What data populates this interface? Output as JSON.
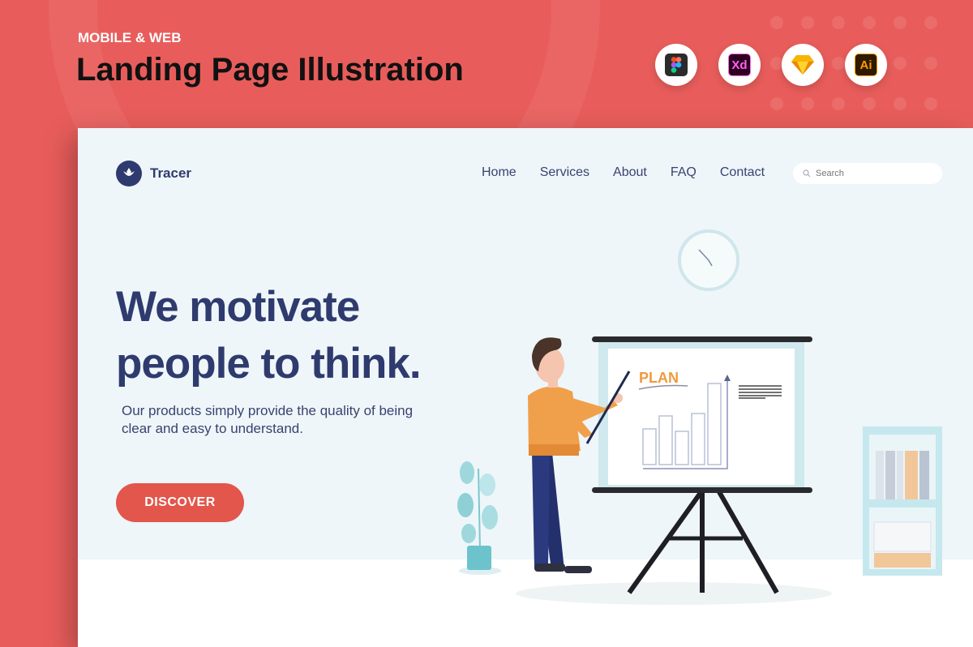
{
  "header": {
    "kicker": "MOBILE & WEB",
    "title": "Landing Page Illustration"
  },
  "tools": [
    {
      "name": "figma-icon",
      "label": ""
    },
    {
      "name": "xd-icon",
      "label": "Xd"
    },
    {
      "name": "sketch-icon",
      "label": ""
    },
    {
      "name": "illustrator-icon",
      "label": "Ai"
    }
  ],
  "site": {
    "brand": "Tracer",
    "nav": [
      "Home",
      "Services",
      "About",
      "FAQ",
      "Contact"
    ],
    "search_placeholder": "Search",
    "hero": {
      "line1": "We motivate",
      "line2": "people to think.",
      "subtitle": "Our products simply provide the quality of being clear and easy to understand.",
      "cta": "DISCOVER"
    },
    "board_title": "PLAN"
  },
  "colors": {
    "background": "#e85d5b",
    "brand": "#2f3a6e",
    "cta": "#e2564c"
  }
}
